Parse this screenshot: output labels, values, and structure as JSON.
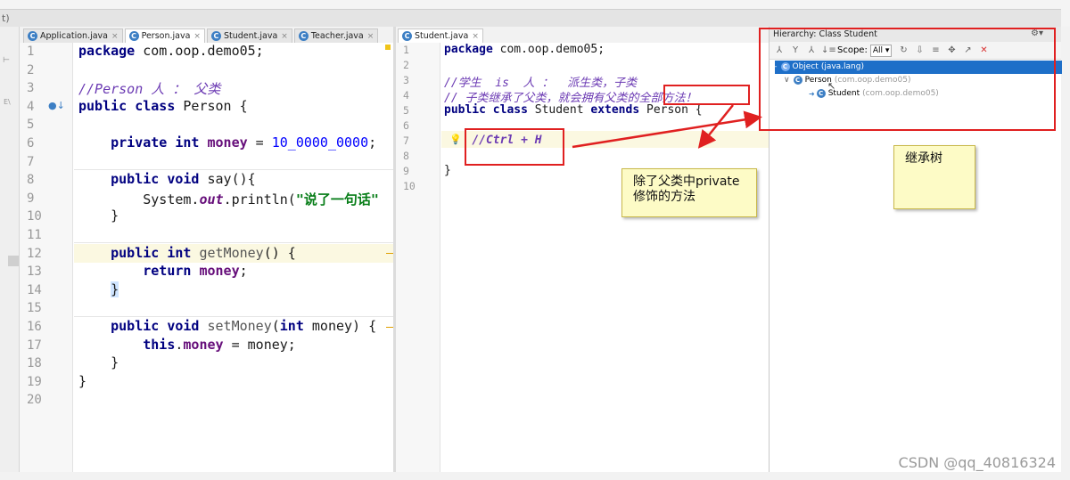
{
  "window": {
    "title_glyph": "t)"
  },
  "left_tabs": [
    {
      "label": "Application.java",
      "active": false
    },
    {
      "label": "Person.java",
      "active": true
    },
    {
      "label": "Student.java",
      "active": false
    },
    {
      "label": "Teacher.java",
      "active": false
    }
  ],
  "right_tabs": [
    {
      "label": "Student.java",
      "active": true
    }
  ],
  "person_lines": [
    "1",
    "2",
    "3",
    "4",
    "5",
    "6",
    "7",
    "8",
    "9",
    "10",
    "11",
    "12",
    "13",
    "14",
    "15",
    "16",
    "17",
    "18",
    "19",
    "20"
  ],
  "person_code": {
    "l1_kw": "package",
    "l1_rest": " com.oop.demo05;",
    "l3": "//Person 人 ： 父类",
    "l4_kw": "public class",
    "l4_rest": " Person {",
    "l6_kw": "private int",
    "l6_fld": "money",
    "l6_eq": " = ",
    "l6_num": "10_0000_0000",
    "l6_end": ";",
    "l8_kw": "public void",
    "l8_rest": " say(){",
    "l9_a": "System.",
    "l9_out": "out",
    "l9_b": ".println(",
    "l9_str": "\"说了一句话\"",
    "l10": "}",
    "l12_kw": "public int",
    "l12_m": "getMoney",
    "l12_rest": "() {",
    "l13_kw": "return",
    "l13_fld": "money",
    "l13_end": ";",
    "l14": "}",
    "l16_kw": "public void",
    "l16_m": "setMoney",
    "l16_a": "(",
    "l16_kw2": "int",
    "l16_b": " money) {",
    "l17_kw": "this",
    "l17_dot": ".",
    "l17_fld": "money",
    "l17_rest": " = money;",
    "l18": "}",
    "l19": "}"
  },
  "student_lines": [
    "1",
    "2",
    "3",
    "4",
    "5",
    "6",
    "7",
    "8",
    "9",
    "10"
  ],
  "student_code": {
    "l1_kw": "package",
    "l1_rest": " com.oop.demo05;",
    "l3": "//学生  is  人 ：  派生类，子类",
    "l4": "// 子类继承了父类，就会拥有父类的全部方法！",
    "l5_kw": "public class",
    "l5_a": " Student ",
    "l5_kw2": "extends",
    "l5_b": " Person {",
    "l7": "//Ctrl + H",
    "l9": "}"
  },
  "hierarchy": {
    "title": "Hierarchy: Class Student",
    "scope_label": "Scope:",
    "scope_value": "All",
    "nodes": [
      {
        "name": "Object",
        "pkg": "(java.lang)",
        "selected": true
      },
      {
        "name": "Person",
        "pkg": "(com.oop.demo05)",
        "selected": false
      },
      {
        "name": "Student",
        "pkg": "(com.oop.demo05)",
        "selected": false
      }
    ]
  },
  "annotations": {
    "note_private_line1": "除了父类中private",
    "note_private_line2": "修饰的方法",
    "note_tree": "继承树"
  },
  "watermark": "CSDN @qq_40816324",
  "colors": {
    "annotation_red": "#e02020",
    "note_bg": "#fdfbc6",
    "selection_blue": "#1e6fc8"
  }
}
